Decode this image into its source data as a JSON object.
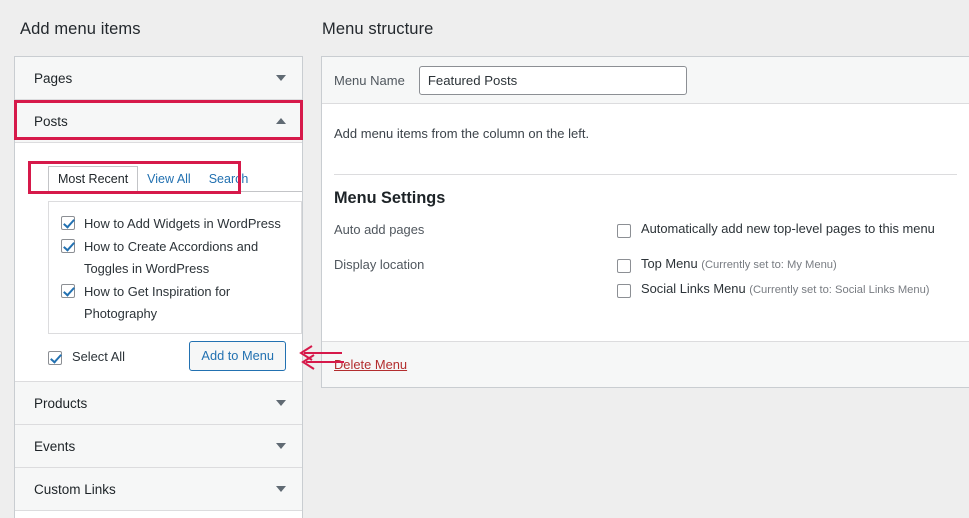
{
  "left": {
    "heading": "Add menu items",
    "accordions": [
      {
        "label": "Pages",
        "state": "collapsed"
      },
      {
        "label": "Posts",
        "state": "expanded"
      },
      {
        "label": "Products",
        "state": "collapsed"
      },
      {
        "label": "Events",
        "state": "collapsed"
      },
      {
        "label": "Custom Links",
        "state": "collapsed"
      }
    ],
    "tabs": [
      {
        "label": "Most Recent",
        "active": true
      },
      {
        "label": "View All",
        "active": false
      },
      {
        "label": "Search",
        "active": false
      }
    ],
    "post_items": [
      {
        "label": "How to Add Widgets in WordPress",
        "checked": true
      },
      {
        "label": "How to Create Accordions and Toggles in WordPress",
        "checked": true
      },
      {
        "label": "How to Get Inspiration for Photography",
        "checked": true
      }
    ],
    "select_all": {
      "label": "Select All",
      "checked": true
    },
    "add_button": "Add to Menu"
  },
  "right": {
    "heading": "Menu structure",
    "menu_name_label": "Menu Name",
    "menu_name_value": "Featured Posts",
    "menu_name_placeholder": "Enter menu name here",
    "empty_note": "Add menu items from the column on the left.",
    "settings_title": "Menu Settings",
    "auto_add": {
      "label": "Auto add pages",
      "option": "Automatically add new top-level pages to this menu",
      "checked": false
    },
    "display_location": {
      "label": "Display location",
      "options": [
        {
          "label": "Top Menu",
          "note": "(Currently set to: My Menu)",
          "checked": false
        },
        {
          "label": "Social Links Menu",
          "note": "(Currently set to: Social Links Menu)",
          "checked": false
        }
      ]
    },
    "delete_menu": "Delete Menu"
  },
  "annotations": {
    "highlight_color": "#d6194a",
    "arrow_color": "#d6194a",
    "highlights": [
      {
        "target": "posts-accordion-header"
      },
      {
        "target": "post-tabs"
      }
    ],
    "arrows": [
      {
        "target": "add-to-menu-button",
        "direction": "left"
      },
      {
        "target": "delete-menu-link",
        "direction": "left"
      }
    ]
  },
  "colors": {
    "page_background": "#eeeeee",
    "panel_background": "#ffffff",
    "panel_border": "#c9cdd1",
    "link_blue": "#2271b1",
    "delete_red": "#b32d2e"
  }
}
